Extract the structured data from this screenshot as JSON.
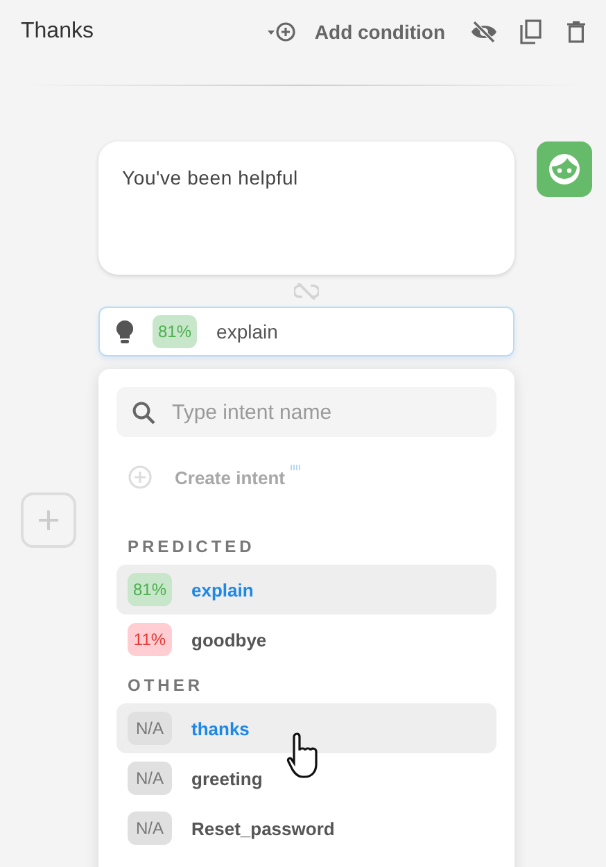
{
  "header": {
    "title": "Thanks",
    "add_condition": "Add condition"
  },
  "message": {
    "text": "You've been helpful"
  },
  "intent_bar": {
    "score": "81%",
    "kind": "high",
    "intent": "explain"
  },
  "dropdown": {
    "search": {
      "placeholder": "Type intent name"
    },
    "create": {
      "label": "Create intent",
      "disabled": true
    },
    "sections": [
      {
        "title": "PREDICTED",
        "items": [
          {
            "score": "81%",
            "kind": "high",
            "name": "explain",
            "selected": true,
            "highlighted": true
          },
          {
            "score": "11%",
            "kind": "low",
            "name": "goodbye",
            "selected": false,
            "highlighted": false
          }
        ]
      },
      {
        "title": "OTHER",
        "items": [
          {
            "score": "N/A",
            "kind": "none",
            "name": "thanks",
            "selected": true,
            "highlighted": true
          },
          {
            "score": "N/A",
            "kind": "none",
            "name": "greeting",
            "selected": false,
            "highlighted": false
          },
          {
            "score": "N/A",
            "kind": "none",
            "name": "Reset_password",
            "selected": false,
            "highlighted": false
          }
        ]
      }
    ]
  }
}
